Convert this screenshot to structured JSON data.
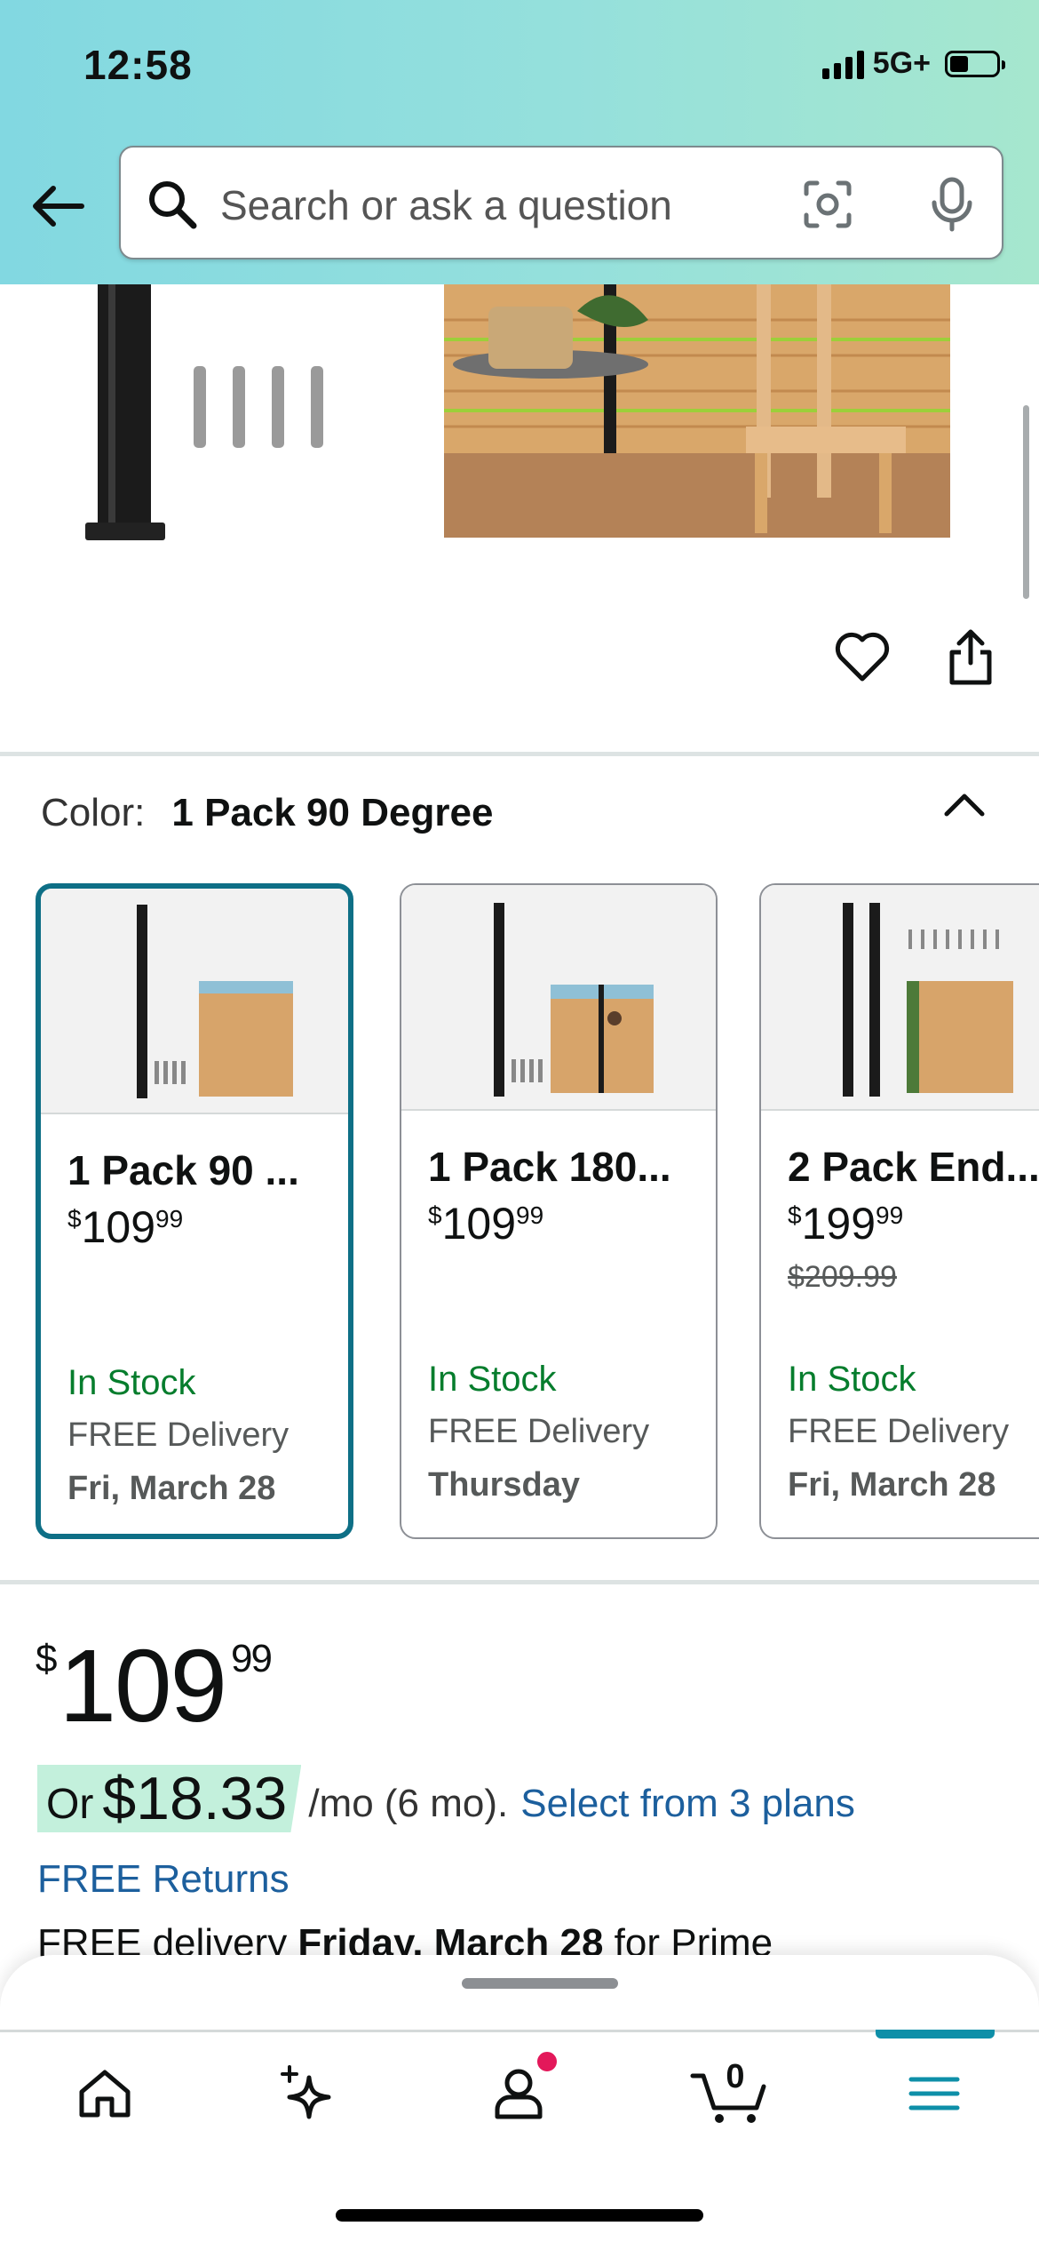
{
  "status_bar": {
    "time": "12:58",
    "network": "5G+"
  },
  "search": {
    "placeholder": "Search or ask a question"
  },
  "gallery": {
    "dot_count": 5,
    "active_dot": 1
  },
  "color_selector": {
    "label": "Color:",
    "selected": "1 Pack 90 Degree",
    "options": [
      {
        "title": "1 Pack 90 ...",
        "price_whole": "109",
        "price_cents": "99",
        "list_price": "",
        "stock": "In Stock",
        "delivery": "FREE Delivery",
        "date": "Fri, March 28",
        "selected": true
      },
      {
        "title": "1 Pack 180...",
        "price_whole": "109",
        "price_cents": "99",
        "list_price": "",
        "stock": "In Stock",
        "delivery": "FREE Delivery",
        "date": "Thursday",
        "selected": false
      },
      {
        "title": "2 Pack End...",
        "price_whole": "199",
        "price_cents": "99",
        "list_price": "$209.99",
        "stock": "In Stock",
        "delivery": "FREE Delivery",
        "date": "Fri, March 28",
        "selected": false
      }
    ]
  },
  "price": {
    "currency": "$",
    "whole": "109",
    "cents": "99"
  },
  "installment": {
    "or": "Or",
    "amount": "$18.33",
    "term": "/mo (6 mo).",
    "link": "Select from 3 plans"
  },
  "free_returns": "FREE Returns",
  "free_delivery": {
    "prefix": "FREE delivery",
    "date": "Friday, March 28",
    "suffix": "for Prime"
  },
  "bottom_nav": {
    "cart_count": "0",
    "items": [
      "home",
      "rufus",
      "account",
      "cart",
      "menu"
    ]
  },
  "colors": {
    "accent": "#0e6f86",
    "link": "#1c5f9d",
    "in_stock": "#067d2d",
    "highlight": "#c3f0dc",
    "badge": "#e3185a"
  }
}
